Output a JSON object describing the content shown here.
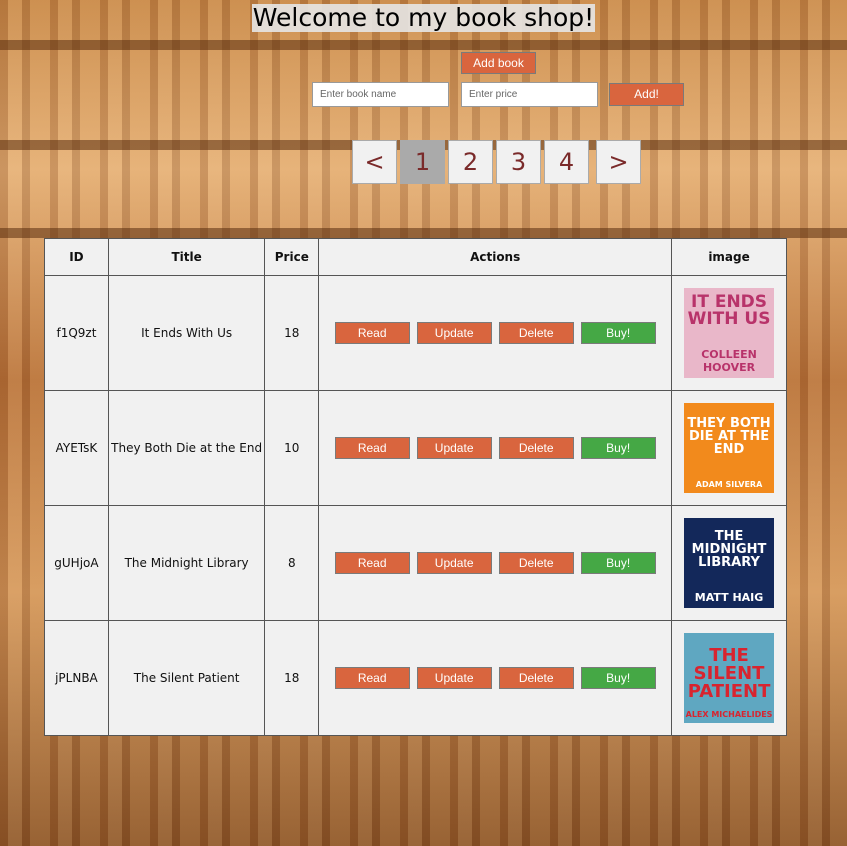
{
  "page": {
    "title": "Welcome to my book shop!"
  },
  "add_form": {
    "add_book_label": "Add book",
    "name_placeholder": "Enter book name",
    "price_placeholder": "Enter price",
    "submit_label": "Add!"
  },
  "pagination": {
    "prev": "<",
    "next": ">",
    "pages": [
      "1",
      "2",
      "3",
      "4"
    ],
    "current": "1"
  },
  "table": {
    "headers": [
      "ID",
      "Title",
      "Price",
      "Actions",
      "image"
    ],
    "actions": {
      "read": "Read",
      "update": "Update",
      "delete": "Delete",
      "buy": "Buy!"
    },
    "rows": [
      {
        "id": "f1Q9zt",
        "title": "It Ends With Us",
        "price": "18",
        "cover": {
          "title": "IT ENDS WITH US",
          "author": "COLLEEN HOOVER",
          "bg": "#e9b7c9",
          "fg": "#b8336a"
        }
      },
      {
        "id": "AYETsK",
        "title": "They Both Die at the End",
        "price": "10",
        "cover": {
          "title": "THEY BOTH DIE AT THE END",
          "author": "ADAM SILVERA",
          "bg": "#f28a1c",
          "fg": "#ffffff"
        }
      },
      {
        "id": "gUHjoA",
        "title": "The Midnight Library",
        "price": "8",
        "cover": {
          "title": "THE MIDNIGHT LIBRARY",
          "author": "MATT HAIG",
          "bg": "#13285a",
          "fg": "#ffffff"
        }
      },
      {
        "id": "jPLNBA",
        "title": "The Silent Patient",
        "price": "18",
        "cover": {
          "title": "THE SILENT PATIENT",
          "author": "ALEX MICHAELIDES",
          "bg": "#5fa7c1",
          "fg": "#d8242f"
        }
      }
    ]
  },
  "colors": {
    "action": "#d9653e",
    "buy": "#45a845",
    "page_active": "#aaaaaa"
  }
}
